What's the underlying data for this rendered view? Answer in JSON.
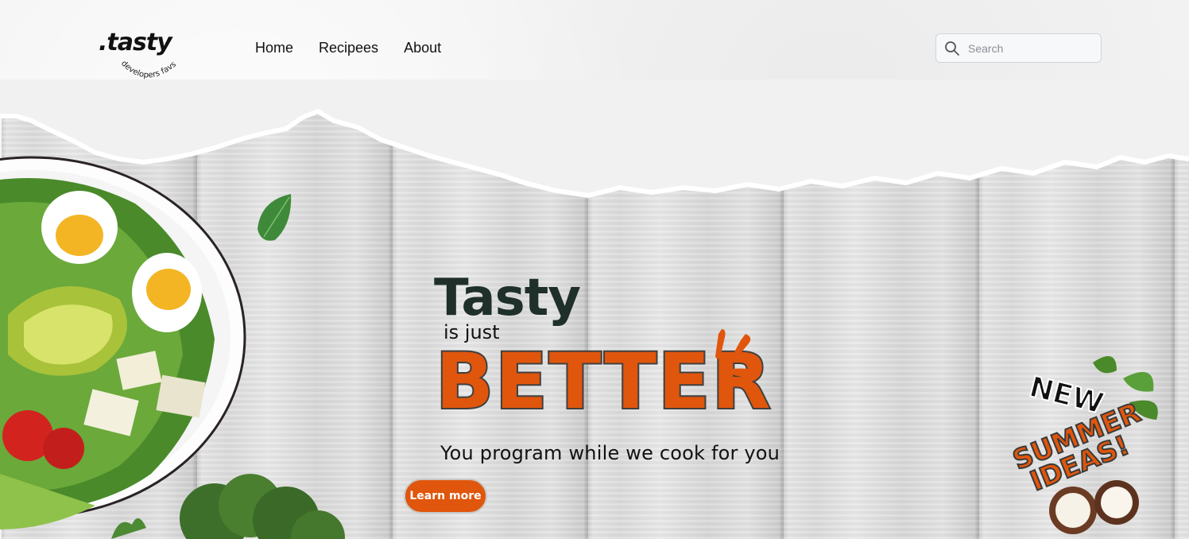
{
  "logo": {
    "word": ".tasty",
    "tagline": "developers favs"
  },
  "nav": {
    "items": [
      "Home",
      "Recipees",
      "About"
    ]
  },
  "search": {
    "placeholder": "Search"
  },
  "hero": {
    "title": "Tasty",
    "connector": "is just",
    "headline": "BETTER",
    "subtitle": "You program while we cook for you",
    "cta_label": "Learn more"
  },
  "sticker": {
    "line1": "NEW",
    "line2": "SUMMER",
    "line3": "IDEAS!"
  },
  "colors": {
    "accent": "#e0560c",
    "title_dark": "#1f2f29",
    "text": "#111111"
  },
  "icons": {
    "search": "search-icon",
    "splash": "splash-accent-icon"
  }
}
